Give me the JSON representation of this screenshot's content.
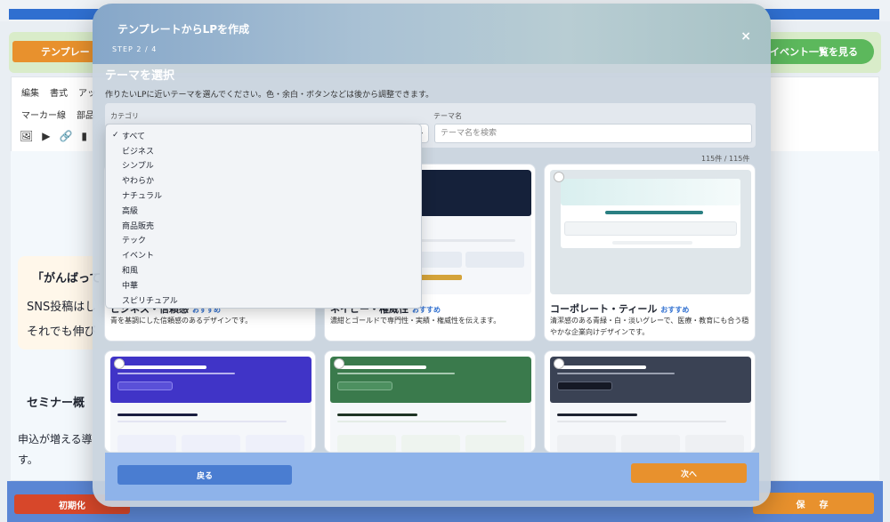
{
  "background": {
    "template_button": "テンプレート",
    "events_button": "イベント一覧を見る",
    "toolbar_row1": [
      "編集",
      "書式",
      "アッ"
    ],
    "toolbar_row2": [
      "マーカー線",
      "部品"
    ],
    "content_texts": [
      "「がんばって",
      "SNS投稿はし",
      "それでも伸び",
      "セミナー概",
      "申込が増える導",
      "す。"
    ],
    "reset_button": "初期化",
    "save_button": "保　存",
    "icons": [
      "image-icon",
      "video-icon",
      "link-icon",
      "bookmark-icon"
    ]
  },
  "modal": {
    "title": "テンプレートからLPを作成",
    "step": "STEP 2 / 4",
    "close_glyph": "×",
    "heading": "テーマを選択",
    "description": "作りたいLPに近いテーマを選んでください。色・余白・ボタンなどは後から調整できます。",
    "category_label": "カテゴリ",
    "themename_label": "テーマ名",
    "search_placeholder": "テーマ名を検索",
    "count": "115件 / 115件",
    "categories": [
      "すべて",
      "ビジネス",
      "シンプル",
      "やわらか",
      "ナチュラル",
      "高級",
      "商品販売",
      "テック",
      "イベント",
      "和風",
      "中華",
      "スピリチュアル"
    ],
    "selected_category": "すべて",
    "cards": [
      {
        "name": "ビジネス・信頼感",
        "badge": "おすすめ",
        "desc": "青を基調にした信頼感のあるデザインです。",
        "accent": "#2f6fd0"
      },
      {
        "name": "ネイビー・権威性",
        "badge": "おすすめ",
        "desc": "濃紺とゴールドで専門性・実績・権威性を伝えます。",
        "accent": "#15213a"
      },
      {
        "name": "コーポレート・ティール",
        "badge": "おすすめ",
        "desc": "清潔感のある青緑・白・淡いグレーで、医療・教育にも合う穏やかな企業向けデザインです。",
        "accent": "#2a7f82"
      },
      {
        "name": "",
        "badge": "",
        "desc": "",
        "accent": "#4034c7"
      },
      {
        "name": "",
        "badge": "",
        "desc": "",
        "accent": "#3a7a4c"
      },
      {
        "name": "",
        "badge": "",
        "desc": "",
        "accent": "#3a4254"
      }
    ],
    "back_button": "戻る",
    "next_button": "次へ"
  }
}
